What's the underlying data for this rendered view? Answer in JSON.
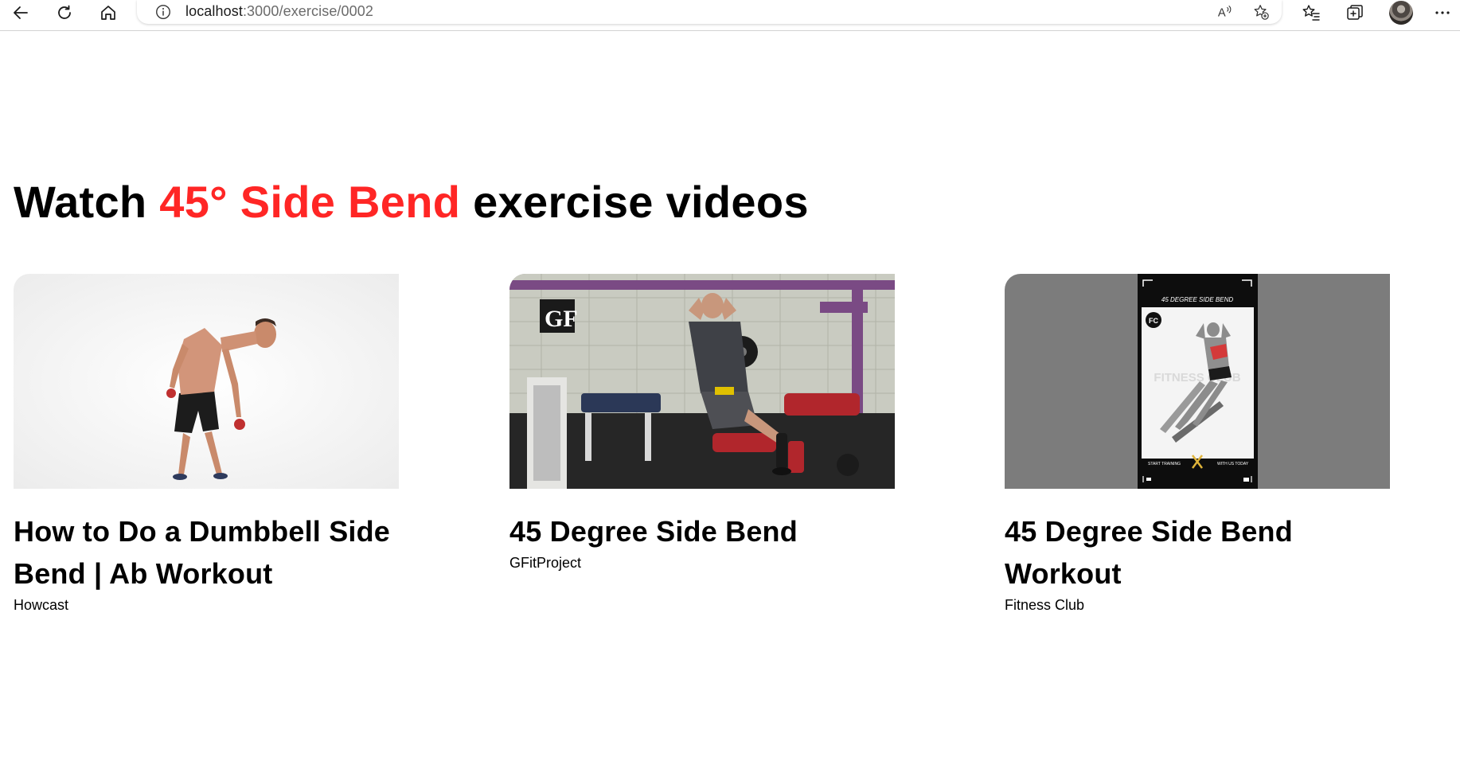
{
  "browser": {
    "url_host": "localhost",
    "url_path": ":3000/exercise/0002",
    "icons": [
      "back-arrow-icon",
      "refresh-icon",
      "home-icon",
      "info-icon",
      "read-aloud-icon",
      "add-favorite-icon",
      "favorites-icon",
      "collections-icon",
      "more-icon"
    ]
  },
  "page": {
    "heading_prefix": "Watch ",
    "heading_accent": "45° Side Bend",
    "heading_suffix": " exercise videos",
    "accent_color": "#ff2625"
  },
  "videos": [
    {
      "title": "How to Do a Dumbbell Side Bend | Ab Workout",
      "channel": "Howcast"
    },
    {
      "title": "45 Degree Side Bend",
      "channel": "GFitProject"
    },
    {
      "title": "45 Degree Side Bend Workout",
      "channel": "Fitness Club",
      "thumbnail_text": {
        "top_banner": "45 DEGREE SIDE BEND",
        "watermark": "FITNESS CLUB",
        "badge": "FC",
        "bottom_left": "START TRAINING",
        "bottom_right": "WITH US TODAY"
      }
    }
  ]
}
